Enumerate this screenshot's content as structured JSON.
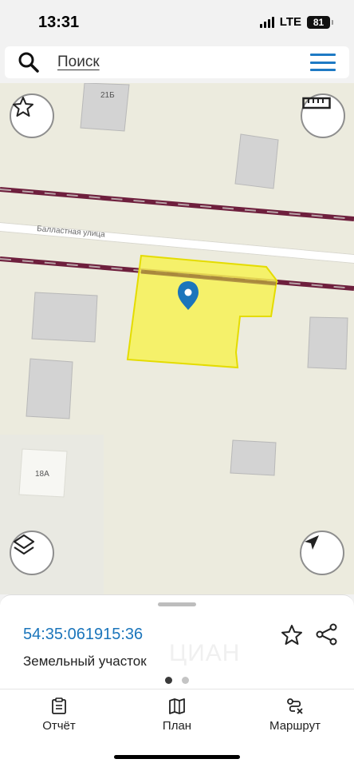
{
  "status_bar": {
    "time": "13:31",
    "network": "LTE",
    "battery": "81"
  },
  "search": {
    "label": "Поиск"
  },
  "map": {
    "street_name": "Балластная улица",
    "building_labels": [
      "21Б",
      "18А"
    ],
    "parcel_color": "#f7f256",
    "marker_color": "#1b75bb",
    "rail_color": "#6e1f3d"
  },
  "object_card": {
    "cadastral_number": "54:35:061915:36",
    "object_type": "Земельный участок",
    "watermark": "ЦИАН",
    "page_count": 2,
    "active_page": 1
  },
  "tabs": [
    {
      "label": "Отчёт",
      "icon": "report-icon"
    },
    {
      "label": "План",
      "icon": "map-icon"
    },
    {
      "label": "Маршрут",
      "icon": "route-icon"
    }
  ]
}
